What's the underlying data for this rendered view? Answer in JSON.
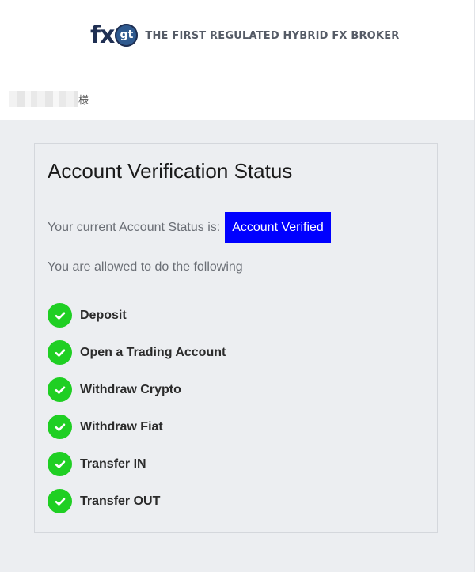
{
  "header": {
    "logo_fx": "fx",
    "logo_gt": "gt",
    "tagline": "THE FIRST REGULATED HYBRID FX BROKER",
    "greeting_suffix": "様"
  },
  "card": {
    "title": "Account Verification Status",
    "status_label": "Your current Account Status is:",
    "status_value": "Account Verified",
    "allowed_text": "You are allowed to do the following",
    "permissions": [
      {
        "label": "Deposit",
        "icon": "check-circle-icon"
      },
      {
        "label": "Open a Trading Account",
        "icon": "check-circle-icon"
      },
      {
        "label": "Withdraw Crypto",
        "icon": "check-circle-icon"
      },
      {
        "label": "Withdraw Fiat",
        "icon": "check-circle-icon"
      },
      {
        "label": "Transfer IN",
        "icon": "check-circle-icon"
      },
      {
        "label": "Transfer OUT",
        "icon": "check-circle-icon"
      }
    ]
  },
  "colors": {
    "status_badge_bg": "#0000ff",
    "check_green": "#1fcf23",
    "page_bg": "#eceef1",
    "logo_navy": "#1f2f52"
  }
}
